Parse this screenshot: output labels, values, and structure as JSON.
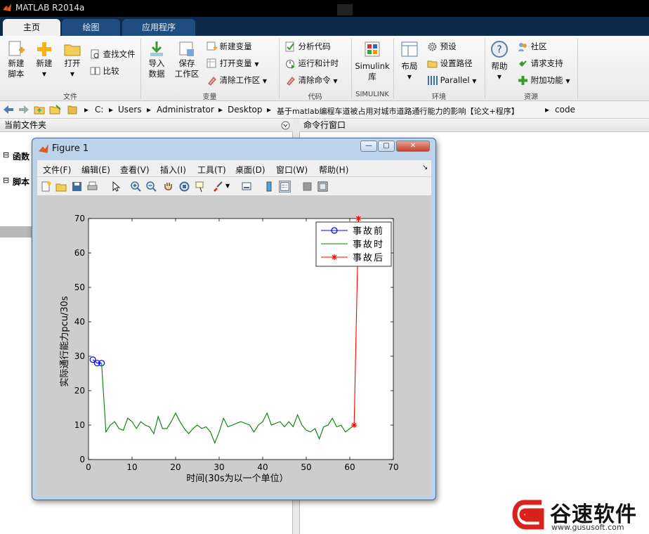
{
  "window": {
    "title": "MATLAB R2014a"
  },
  "tabs": [
    {
      "label": "主页",
      "active": true
    },
    {
      "label": "绘图",
      "active": false
    },
    {
      "label": "应用程序",
      "active": false
    }
  ],
  "ribbon": {
    "file": {
      "new_script": [
        "新建",
        "脚本"
      ],
      "new": "新建",
      "open": "打开",
      "find_files": "查找文件",
      "compare": "比较",
      "section": "文件"
    },
    "variable": {
      "import": [
        "导入",
        "数据"
      ],
      "save_workspace": [
        "保存",
        "工作区"
      ],
      "new_variable": "新建变量",
      "open_variable": "打开变量",
      "clear_workspace": "清除工作区",
      "section": "变量"
    },
    "code": {
      "analyze": "分析代码",
      "run_time": "运行和计时",
      "clear_commands": "清除命令",
      "section": "代码"
    },
    "simulink": {
      "label": [
        "Simulink",
        "库"
      ],
      "section": "SIMULINK"
    },
    "environment": {
      "layout": "布局",
      "preferences": "预设",
      "set_path": "设置路径",
      "parallel": "Parallel",
      "section": "环境"
    },
    "resources": {
      "help": "帮助",
      "community": "社区",
      "request_support": "请求支持",
      "addons": "附加功能",
      "section": "资源"
    }
  },
  "address": {
    "crumbs": [
      "C:",
      "Users",
      "Administrator",
      "Desktop",
      "基于matlab编程车道被占用对城市道路通行能力的影响【论文+程序】",
      "code"
    ]
  },
  "panels": {
    "current_folder": "当前文件夹",
    "command_window": "命令行窗口",
    "left_items": [
      "函数",
      "脚本"
    ]
  },
  "figure": {
    "title": "Figure 1",
    "menu": [
      "文件(F)",
      "编辑(E)",
      "查看(V)",
      "插入(I)",
      "工具(T)",
      "桌面(D)",
      "窗口(W)",
      "帮助(H)"
    ]
  },
  "chart_data": {
    "type": "line",
    "xlabel": "时间(30s为以一个单位）",
    "ylabel": "实际通行能力pcu/30s",
    "xlim": [
      0,
      70
    ],
    "ylim": [
      0,
      70
    ],
    "xticks": [
      0,
      10,
      20,
      30,
      40,
      50,
      60,
      70
    ],
    "yticks": [
      0,
      10,
      20,
      30,
      40,
      50,
      60,
      70
    ],
    "legend_position": "top-right",
    "series": [
      {
        "name": "事故前",
        "color": "#0000ff",
        "marker": "circle",
        "x": [
          1,
          2,
          3
        ],
        "y": [
          29,
          28,
          28
        ]
      },
      {
        "name": "事故时",
        "color": "#008000",
        "marker": "none",
        "x": [
          3,
          4,
          5,
          6,
          7,
          8,
          9,
          10,
          11,
          12,
          13,
          14,
          15,
          16,
          17,
          18,
          19,
          20,
          21,
          22,
          23,
          24,
          25,
          26,
          27,
          28,
          29,
          30,
          31,
          32,
          33,
          34,
          35,
          36,
          37,
          38,
          39,
          40,
          41,
          42,
          43,
          44,
          45,
          46,
          47,
          48,
          49,
          50,
          51,
          52,
          53,
          54,
          55,
          56,
          57,
          58,
          59,
          60,
          61
        ],
        "y": [
          28,
          8,
          10,
          11,
          9,
          8.5,
          12,
          11,
          9,
          11,
          10,
          9.5,
          7.5,
          12.5,
          9,
          9,
          11,
          13.5,
          11,
          9,
          7.5,
          9,
          10,
          9,
          9.5,
          8,
          4.8,
          8,
          12,
          9.5,
          10,
          10.5,
          11,
          10.5,
          10,
          8,
          10,
          11,
          13.5,
          10,
          10.5,
          11,
          9.5,
          11,
          9.5,
          13,
          10,
          8.5,
          8,
          9,
          6,
          9.5,
          10,
          12,
          9.5,
          10,
          8,
          9,
          10
        ]
      },
      {
        "name": "事故后",
        "color": "#ff0000",
        "marker": "star",
        "x": [
          61,
          62
        ],
        "y": [
          10,
          70
        ]
      }
    ]
  },
  "watermark": {
    "brand": "谷速软件",
    "url": "www.gususoft.com"
  }
}
